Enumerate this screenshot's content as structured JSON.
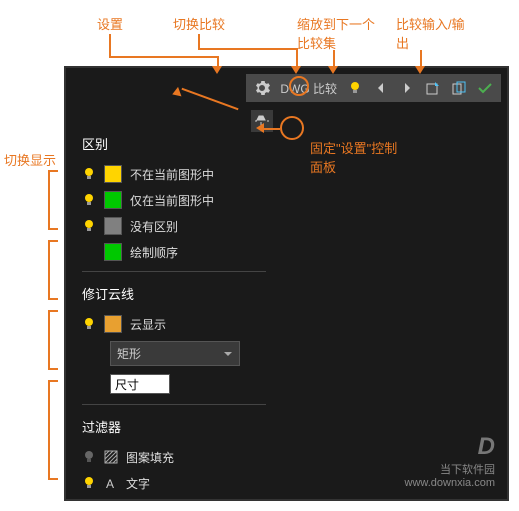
{
  "annotations": {
    "settings": "设置",
    "toggle_compare": "切换比较",
    "zoom_next": "缩放到下一个比较集",
    "io": "比较输入/输出",
    "toggle_display": "切换显示",
    "pin_panel": "固定\"设置\"控制面板"
  },
  "toolbar": {
    "title": "DWG 比较"
  },
  "panel": {
    "section_diff": "区别",
    "not_in_current": "不在当前图形中",
    "only_in_current": "仅在当前图形中",
    "no_diff": "没有区别",
    "draw_order": "绘制顺序",
    "section_cloud": "修订云线",
    "cloud_display": "云显示",
    "shape_dropdown": "矩形",
    "size_input": "尺寸",
    "section_filter": "过滤器",
    "pattern_fill": "图案填充",
    "text": "文字"
  },
  "colors": {
    "yellow": "#ffd400",
    "green": "#00c800",
    "gray": "#808080",
    "darkgray": "#4a4a4a"
  },
  "watermark": {
    "name": "当下软件园",
    "url": "www.downxia.com"
  }
}
